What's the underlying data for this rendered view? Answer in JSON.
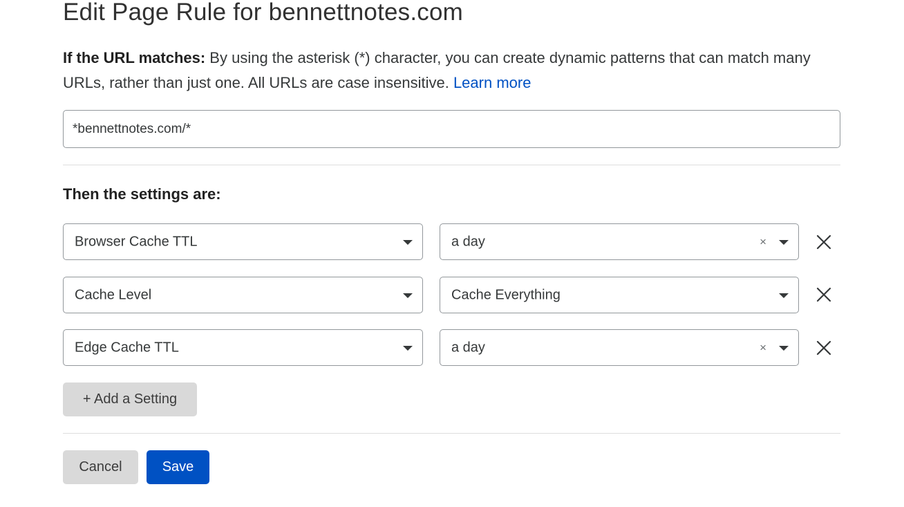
{
  "page": {
    "title": "Edit Page Rule for bennettnotes.com"
  },
  "url_section": {
    "label": "If the URL matches:",
    "description": " By using the asterisk (*) character, you can create dynamic patterns that can match many URLs, rather than just one. All URLs are case insensitive. ",
    "learn_more": "Learn more",
    "url_value": "*bennettnotes.com/*"
  },
  "settings_section": {
    "heading": "Then the settings are:",
    "rows": [
      {
        "setting": "Browser Cache TTL",
        "value": "a day",
        "clearable": true,
        "clear_glyph": "×"
      },
      {
        "setting": "Cache Level",
        "value": "Cache Everything",
        "clearable": false
      },
      {
        "setting": "Edge Cache TTL",
        "value": "a day",
        "clearable": true,
        "clear_glyph": "×"
      }
    ],
    "add_setting_label": "+ Add a Setting"
  },
  "actions": {
    "cancel_label": "Cancel",
    "save_label": "Save"
  },
  "colors": {
    "primary": "#0051c3",
    "secondary_button": "#d9d9d9",
    "link": "#0051c3",
    "border": "#92979b"
  },
  "icons": {
    "dropdown": "chevron-down-icon",
    "clear": "clear-icon",
    "remove": "close-icon"
  }
}
